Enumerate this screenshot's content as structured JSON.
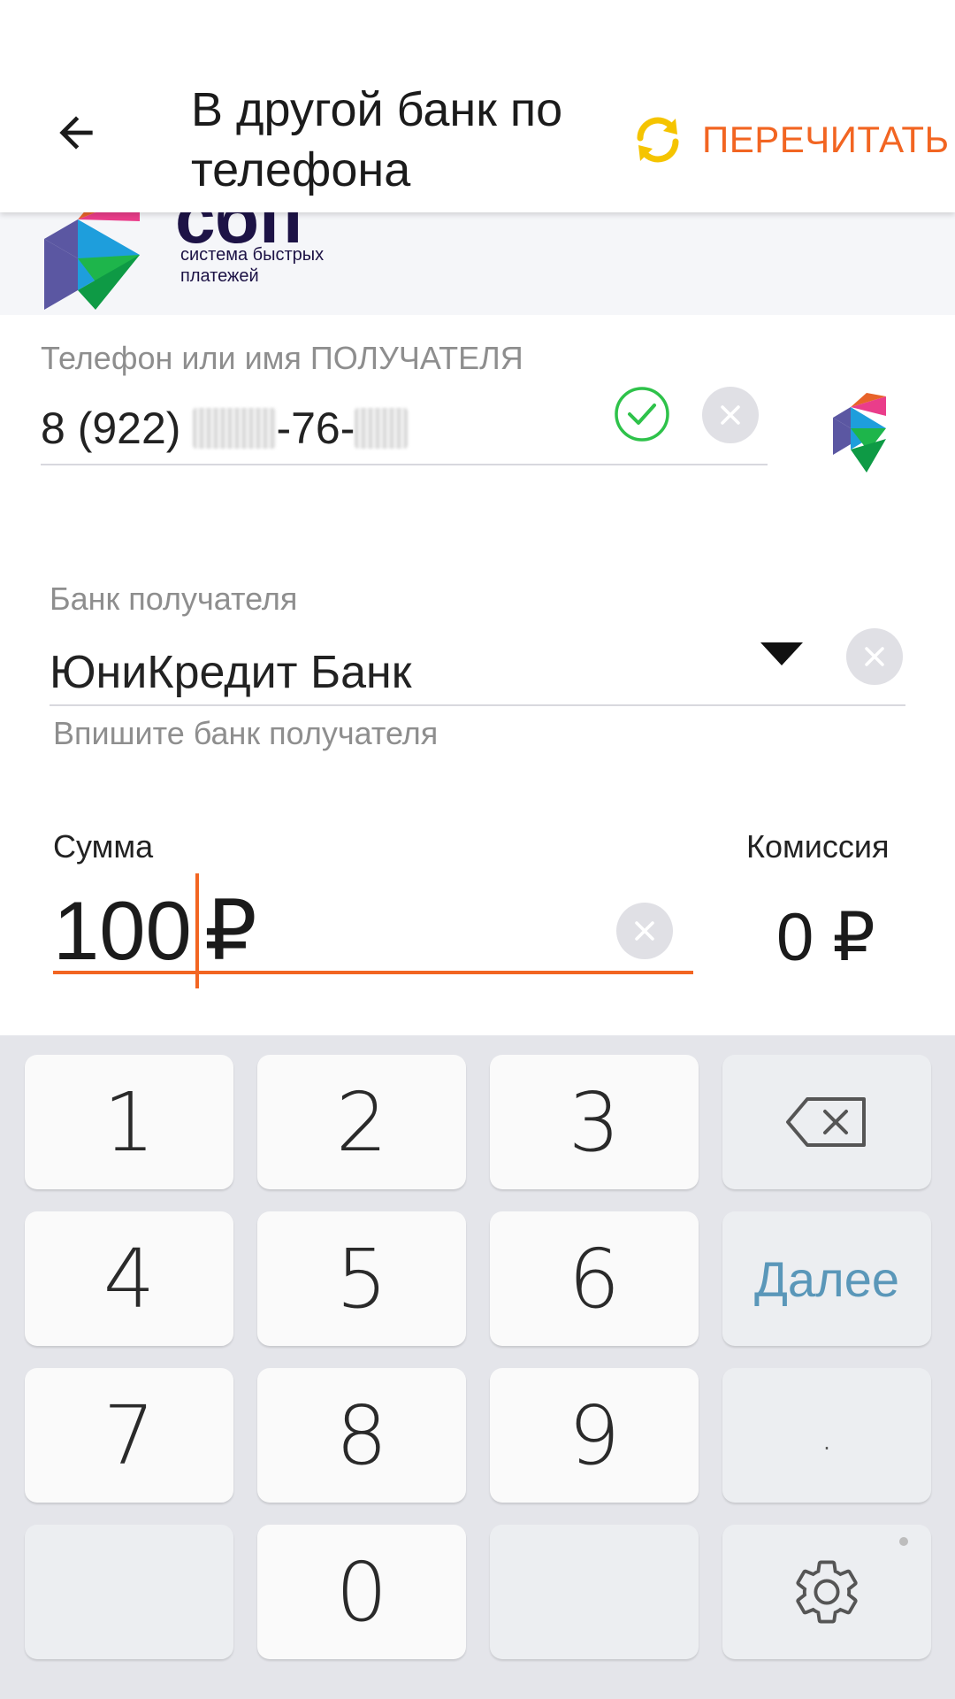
{
  "app_bar": {
    "title": "В другой банк по телефона",
    "reload_label": "ПЕРЕЧИТАТЬ"
  },
  "banner": {
    "logo_word": "сбп",
    "logo_subtitle": "система быстрых платежей"
  },
  "phone": {
    "label": "Телефон или имя ПОЛУЧАТЕЛЯ",
    "prefix": "8 (922)",
    "middle": "-76-"
  },
  "bank": {
    "label": "Банк получателя",
    "value": "ЮниКредит Банк",
    "hint": "Впишите банк получателя"
  },
  "amount": {
    "label": "Сумма",
    "value": "100",
    "currency": "₽"
  },
  "fee": {
    "label": "Комиссия",
    "value": "0 ₽"
  },
  "keyboard": {
    "keys": [
      "1",
      "2",
      "3",
      "4",
      "5",
      "6",
      "7",
      "8",
      "9",
      "0"
    ],
    "next_label": "Далее",
    "dot_label": "."
  },
  "colors": {
    "accent": "#f26522",
    "reload_icon": "#f5c400",
    "check": "#2ec24a",
    "next_key_text": "#5a97b9"
  }
}
